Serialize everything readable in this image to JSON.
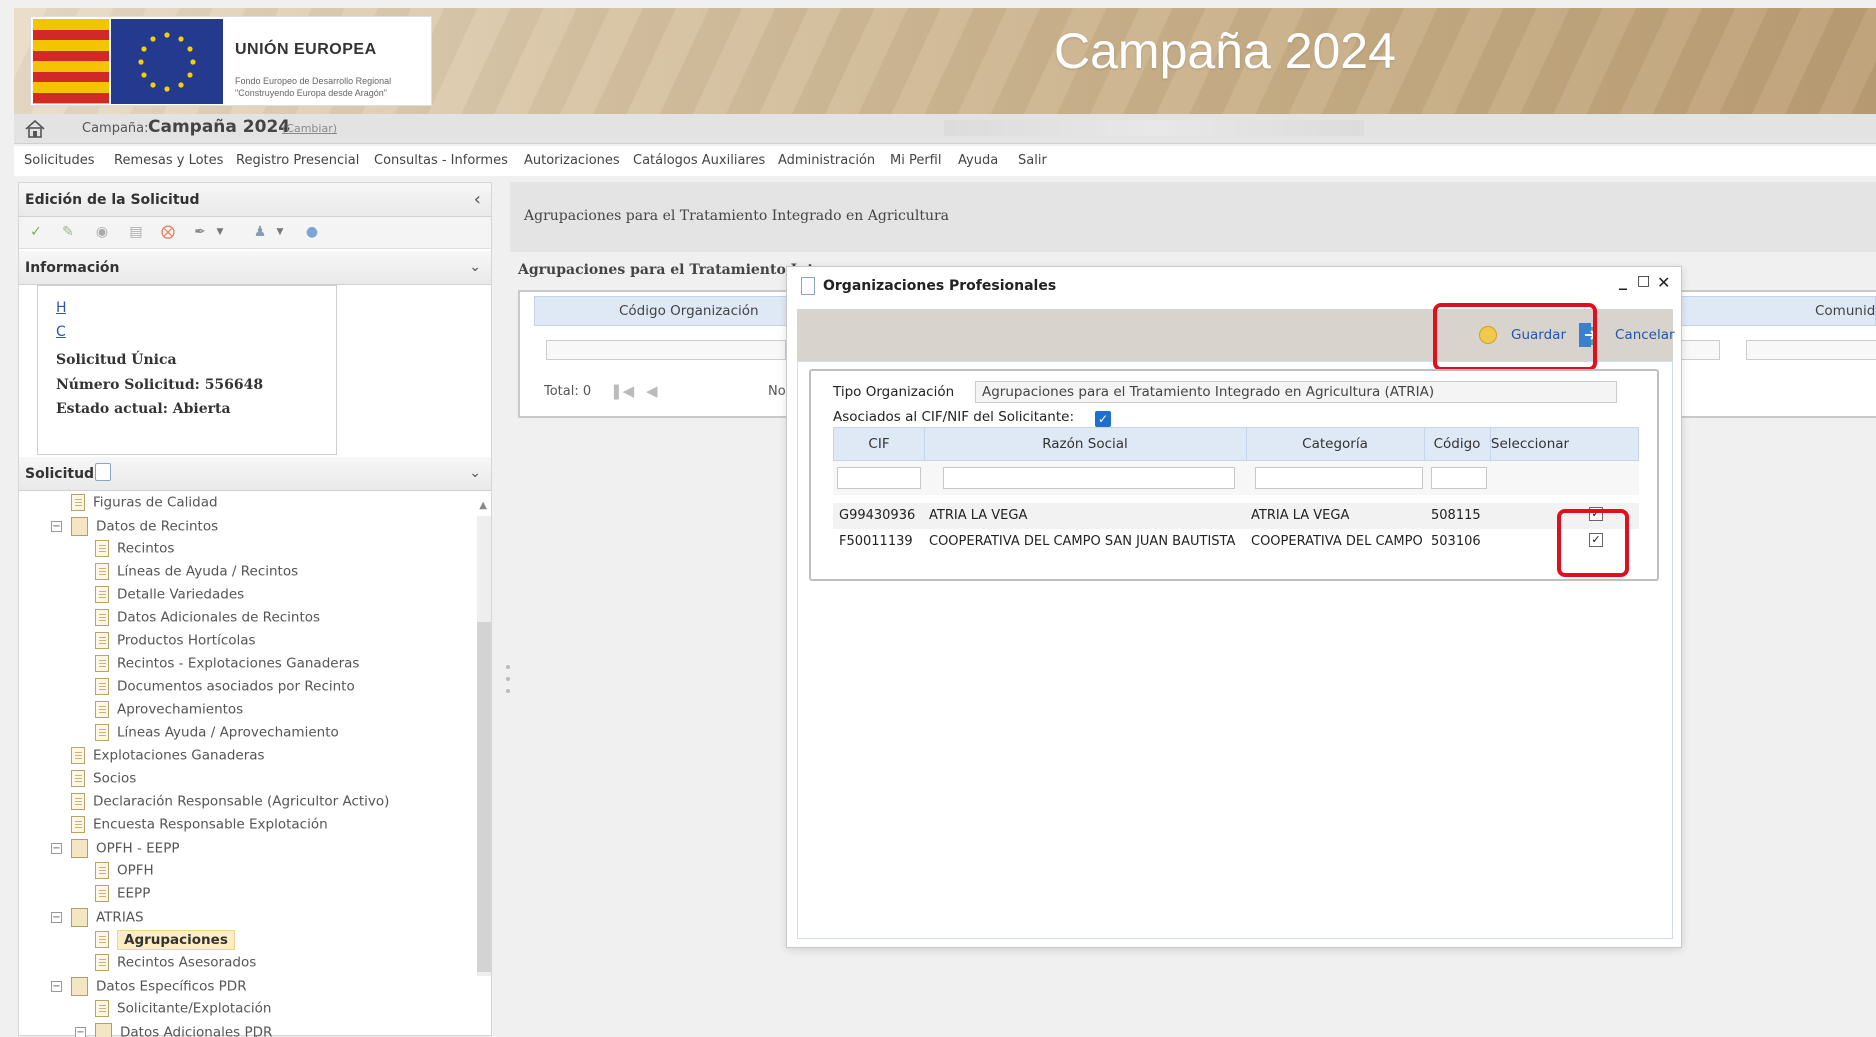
{
  "banner": {
    "eu_title": "UNIÓN EUROPEA",
    "eu_subtitle_1": "Fondo Europeo de Desarrollo Regional",
    "eu_subtitle_2": "\"Construyendo Europa desde Aragón\"",
    "campaign_title": "Campaña 2024"
  },
  "campaign_bar": {
    "label": "Campaña:",
    "value": "Campaña 2024",
    "change_link": "(Cambiar)"
  },
  "menu": {
    "items": [
      "Solicitudes",
      "Remesas y Lotes",
      "Registro Presencial",
      "Consultas - Informes",
      "Autorizaciones",
      "Catálogos Auxiliares",
      "Administración",
      "Mi Perfil",
      "Ayuda",
      "Salir"
    ]
  },
  "left_panel": {
    "edit_title": "Edición de la Solicitud",
    "info_title": "Información",
    "info": {
      "link_1": "H",
      "link_2": "C",
      "line_1": "Solicitud Única",
      "line_2": "Número Solicitud: 556648",
      "line_3": "Estado actual: Abierta"
    },
    "solicitud_title": "Solicitud",
    "tree": [
      {
        "label": "Figuras de Calidad"
      },
      {
        "label": "Datos de Recintos"
      },
      {
        "label": "Recintos"
      },
      {
        "label": "Líneas de Ayuda / Recintos"
      },
      {
        "label": "Detalle Variedades"
      },
      {
        "label": "Datos Adicionales de Recintos"
      },
      {
        "label": "Productos Hortícolas"
      },
      {
        "label": "Recintos - Explotaciones Ganaderas"
      },
      {
        "label": "Documentos asociados por Recinto"
      },
      {
        "label": "Aprovechamientos"
      },
      {
        "label": "Líneas Ayuda / Aprovechamiento"
      },
      {
        "label": "Explotaciones Ganaderas"
      },
      {
        "label": "Socios"
      },
      {
        "label": "Declaración Responsable (Agricultor Activo)"
      },
      {
        "label": "Encuesta Responsable Explotación"
      },
      {
        "label": "OPFH - EEPP"
      },
      {
        "label": "OPFH"
      },
      {
        "label": "EEPP"
      },
      {
        "label": "ATRIAS"
      },
      {
        "label": "Agrupaciones"
      },
      {
        "label": "Recintos Asesorados"
      },
      {
        "label": "Datos Específicos PDR"
      },
      {
        "label": "Solicitante/Explotación"
      },
      {
        "label": "Datos Adicionales PDR"
      }
    ]
  },
  "main": {
    "title": "Agrupaciones para el Tratamiento Integrado en Agricultura",
    "subtitle": "Agrupaciones para el Tratamiento Int",
    "grid_col_1": "Código Organización",
    "grid_col_2": "Comunida",
    "total_label": "Total: 0",
    "no_label": "No"
  },
  "modal": {
    "title": "Organizaciones Profesionales",
    "save_label": "Guardar",
    "cancel_label": "Cancelar",
    "tipo_label": "Tipo Organización",
    "tipo_value": "Agrupaciones para el Tratamiento Integrado en Agricultura (ATRIA)",
    "asociados_label": "Asociados al CIF/NIF del Solicitante:",
    "asociados_checked": true,
    "columns": [
      "CIF",
      "Razón Social",
      "Categoría",
      "Código",
      "Seleccionar"
    ],
    "rows": [
      {
        "cif": "G99430936",
        "razon": "ATRIA LA VEGA",
        "categoria": "ATRIA LA VEGA",
        "codigo": "508115",
        "selected": true
      },
      {
        "cif": "F50011139",
        "razon": "COOPERATIVA DEL CAMPO SAN JUAN BAUTISTA",
        "categoria": "COOPERATIVA DEL CAMPO",
        "codigo": "503106",
        "selected": true
      }
    ]
  },
  "colors": {
    "highlight": "#e10f1e",
    "link_blue": "#1e56b0",
    "grid_header": "#dfe9f6"
  }
}
